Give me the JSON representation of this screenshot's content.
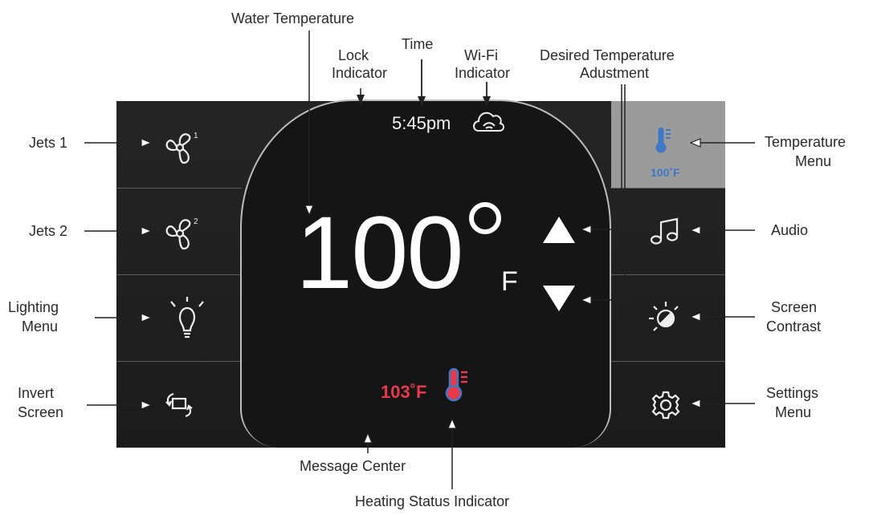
{
  "labels": {
    "water_temperature": "Water Temperature",
    "lock_indicator_1": "Lock",
    "lock_indicator_2": "Indicator",
    "time_label": "Time",
    "wifi_1": "Wi-Fi",
    "wifi_2": "Indicator",
    "desired_1": "Desired Temperature",
    "desired_2": "Adustment",
    "jets1": "Jets 1",
    "jets2": "Jets 2",
    "lighting_1": "Lighting",
    "lighting_2": "Menu",
    "invert_1": "Invert",
    "invert_2": "Screen",
    "tempmenu_1": "Temperature",
    "tempmenu_2": "Menu",
    "audio": "Audio",
    "contrast_1": "Screen",
    "contrast_2": "Contrast",
    "settings_1": "Settings",
    "settings_2": "Menu",
    "message_center": "Message Center",
    "heating_status": "Heating Status Indicator"
  },
  "display": {
    "time": "5:45pm",
    "water_temp": "100",
    "unit": "F",
    "set_temp": "103˚F",
    "menu_temp": "100˚F"
  },
  "icons": {
    "jets1": "fan-1-icon",
    "jets2": "fan-2-icon",
    "lighting": "bulb-icon",
    "invert": "rotate-screen-icon",
    "temperature_menu": "thermometer-icon",
    "audio": "music-note-icon",
    "contrast": "contrast-icon",
    "settings": "gear-icon",
    "wifi": "wifi-cloud-icon",
    "up": "up-arrow-icon",
    "down": "down-arrow-icon",
    "heating": "thermometer-hot-icon"
  },
  "colors": {
    "panel": "#1e1e1e",
    "active_tab": "#9b9b9b",
    "set_temp": "#e8394a",
    "menu_temp": "#3f78c6"
  }
}
